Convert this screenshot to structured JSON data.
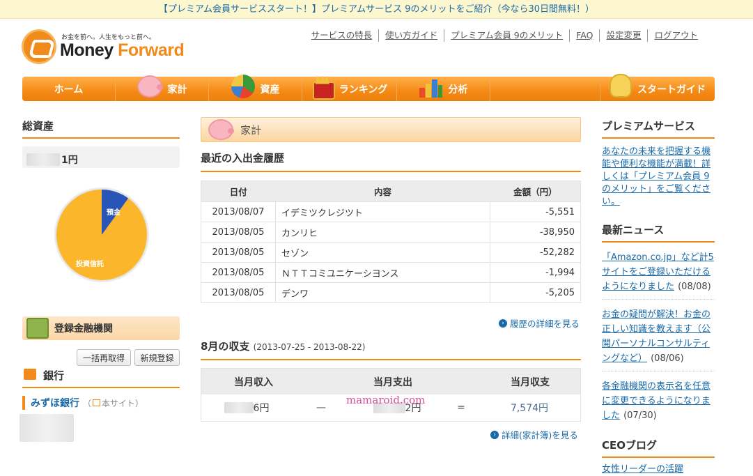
{
  "banner": {
    "text": "【プレミアム会員サービススタート！】プレミアムサービス 9のメリットをご紹介（今なら30日間無料！）"
  },
  "logo": {
    "tagline": "お金を前へ。人生をもっと前へ。",
    "name_1": "Money",
    "name_2": "Forward"
  },
  "toplinks": [
    "サービスの特長",
    "使い方ガイド",
    "プレミアム会員 9のメリット",
    "FAQ",
    "設定変更",
    "ログアウト"
  ],
  "nav": [
    "ホーム",
    "家計",
    "資産",
    "ランキング",
    "分析",
    "スタートガイド"
  ],
  "left": {
    "total_title": "総資産",
    "total_value": "1円",
    "pie": {
      "slices": [
        {
          "label": "預金",
          "share": 0.1
        },
        {
          "label": "投資信託",
          "share": 0.9
        }
      ],
      "colors": {
        "預金": "#2a55b8",
        "投資信託": "#fbb62c"
      }
    },
    "registered_title": "登録金融機関",
    "refresh_button": "一括再取得",
    "new_button": "新規登録",
    "bank_title": "銀行",
    "bank_name": "みずほ銀行",
    "bank_sub_open": "（",
    "bank_sub": "本サイト）"
  },
  "main": {
    "section_title": "家計",
    "recent_title": "最近の入出金履歴",
    "columns": [
      "日付",
      "内容",
      "金額（円）"
    ],
    "rows": [
      {
        "date": "2013/08/07",
        "desc": "イデミツクレジツト",
        "amount": "-5,551"
      },
      {
        "date": "2013/08/05",
        "desc": "カンリヒ",
        "amount": "-38,950"
      },
      {
        "date": "2013/08/05",
        "desc": "セゾン",
        "amount": "-52,282"
      },
      {
        "date": "2013/08/05",
        "desc": "ＮＴＴコミユニケーシヨンス",
        "amount": "-1,994"
      },
      {
        "date": "2013/08/05",
        "desc": "デンワ",
        "amount": "-5,205"
      }
    ],
    "history_more": "履歴の詳細を見る",
    "month_title": "8月の収支",
    "month_range": "(2013-07-25 - 2013-08-22)",
    "sum_headers": [
      "当月収入",
      "当月支出",
      "当月収支"
    ],
    "income": "6円",
    "expense": "2円",
    "minus": "—",
    "equals": "=",
    "balance": "7,574円",
    "detail_more": "詳細(家計簿)を見る",
    "watermark": "mamaroid.com"
  },
  "right": {
    "premium_title": "プレミアムサービス",
    "premium_text": "あなたの未来を把握する機能や便利な機能が満載！詳しくは「プレミアム会員 9のメリット」をご覧ください。",
    "news_title": "最新ニュース",
    "news": [
      {
        "text": "「Amazon.co.jp」など計5サイトをご登録いただけるようになりました",
        "date": "(08/08)"
      },
      {
        "text": "お金の疑問が解決！お金の正しい知識を教えます（公開パーソナルコンサルティングなど）",
        "date": "(08/06)"
      },
      {
        "text": "各金融機関の表示名を任意に変更できるようになりました",
        "date": "(07/30)"
      }
    ],
    "ceo_title": "CEOブログ",
    "ceo_link": "女性リーダーの活躍"
  }
}
